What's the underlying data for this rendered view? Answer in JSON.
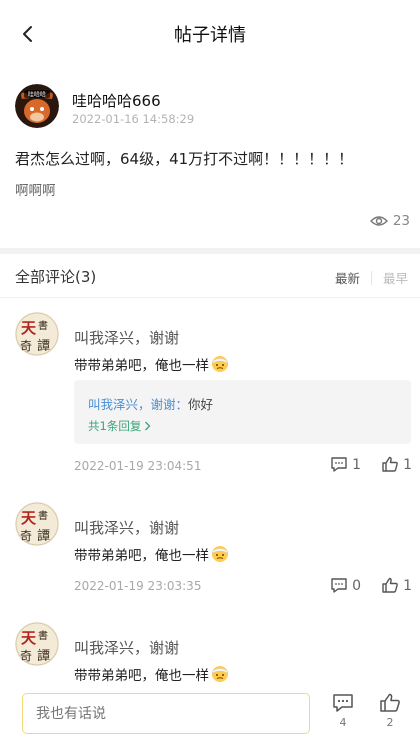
{
  "header": {
    "title": "帖子详情"
  },
  "post": {
    "author": "哇哈哈哈666",
    "avatar_badge": "哇哈哈",
    "time": "2022-01-16 14:58:29",
    "title": "君杰怎么过啊，64级，41万打不过啊！！！！！！",
    "body": "啊啊啊",
    "views": "23"
  },
  "comments_section": {
    "title": "全部评论(3)",
    "sort_latest": "最新",
    "sort_earliest": "最早"
  },
  "comments": [
    {
      "name": "叫我泽兴，谢谢",
      "text": "带带弟弟吧，俺也一样",
      "reply": {
        "author": "叫我泽兴，谢谢",
        "separator": "：",
        "text": "你好",
        "more": "共1条回复"
      },
      "time": "2022-01-19 23:04:51",
      "comments": "1",
      "likes": "1"
    },
    {
      "name": "叫我泽兴，谢谢",
      "text": "带带弟弟吧，俺也一样",
      "time": "2022-01-19 23:03:35",
      "comments": "0",
      "likes": "1"
    },
    {
      "name": "叫我泽兴，谢谢",
      "text": "带带弟弟吧，俺也一样"
    }
  ],
  "footer": {
    "input_placeholder": "我也有话说",
    "comment_count": "4",
    "like_count": "2"
  },
  "colors": {
    "accent_border": "#f3d97a",
    "reply_link": "#4a8fd4",
    "reply_more": "#3aa57a"
  }
}
